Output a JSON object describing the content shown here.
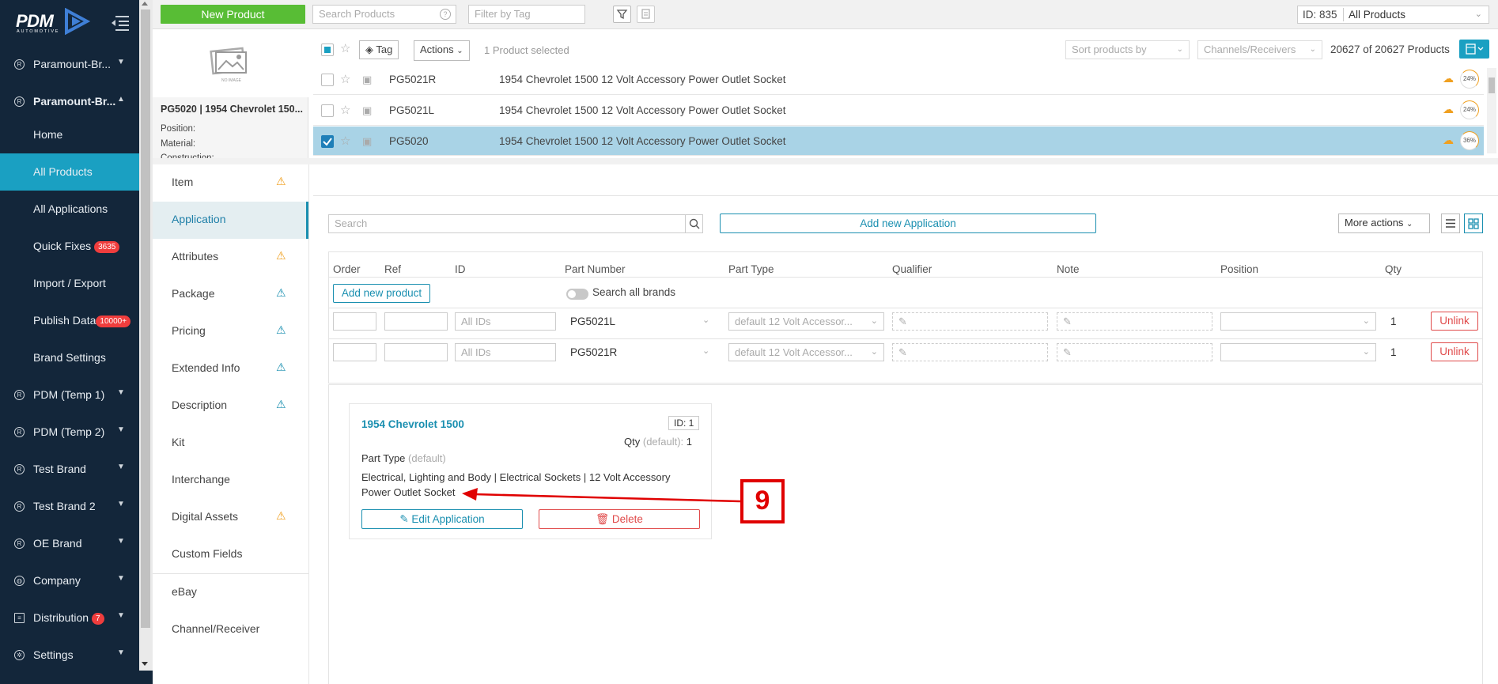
{
  "sidebar": {
    "logo_text": "PDM",
    "logo_sub": "AUTOMOTIVE",
    "items": [
      {
        "label": "Paramount-Br...",
        "type": "brand"
      },
      {
        "label": "Paramount-Br...",
        "type": "brand-open"
      },
      {
        "label": "Home",
        "type": "sub"
      },
      {
        "label": "All Products",
        "type": "sub-active"
      },
      {
        "label": "All Applications",
        "type": "sub"
      },
      {
        "label": "Quick Fixes",
        "type": "sub",
        "badge": "3635"
      },
      {
        "label": "Import / Export",
        "type": "sub"
      },
      {
        "label": "Publish Data",
        "type": "sub",
        "badge": "10000+"
      },
      {
        "label": "Brand Settings",
        "type": "sub"
      },
      {
        "label": "PDM (Temp 1)",
        "type": "brand"
      },
      {
        "label": "PDM (Temp 2)",
        "type": "brand"
      },
      {
        "label": "Test Brand",
        "type": "brand"
      },
      {
        "label": "Test Brand 2",
        "type": "brand"
      },
      {
        "label": "OE Brand",
        "type": "brand"
      },
      {
        "label": "Company",
        "type": "globe"
      },
      {
        "label": "Distribution",
        "type": "dist",
        "badge": "7"
      },
      {
        "label": "Settings",
        "type": "gear"
      }
    ]
  },
  "topbar": {
    "new_product": "New Product",
    "search_placeholder": "Search Products",
    "filter_placeholder": "Filter by Tag",
    "id_label": "ID: 835",
    "view_select": "All Products"
  },
  "product_card": {
    "no_image": "NO IMAGE",
    "title": "PG5020 | 1954 Chevrolet 150...",
    "position_label": "Position:",
    "material_label": "Material:",
    "construction_label": "Construction:"
  },
  "list_toolbar": {
    "tag": "Tag",
    "actions": "Actions",
    "selected": "1 Product selected",
    "sort": "Sort products by",
    "channels": "Channels/Receivers",
    "count": "20627 of 20627 Products"
  },
  "products": [
    {
      "sku": "PG5021R",
      "desc": "1954 Chevrolet 1500 12 Volt Accessory Power Outlet Socket",
      "pct": "24%",
      "selected": false
    },
    {
      "sku": "PG5021L",
      "desc": "1954 Chevrolet 1500 12 Volt Accessory Power Outlet Socket",
      "pct": "24%",
      "selected": false
    },
    {
      "sku": "PG5020",
      "desc": "1954 Chevrolet 1500 12 Volt Accessory Power Outlet Socket",
      "pct": "36%",
      "selected": true
    }
  ],
  "left_nav": [
    {
      "label": "Item",
      "warn": "orange"
    },
    {
      "label": "Application",
      "warn": "",
      "active": true
    },
    {
      "label": "Attributes",
      "warn": "orange"
    },
    {
      "label": "Package",
      "warn": "blue"
    },
    {
      "label": "Pricing",
      "warn": "blue"
    },
    {
      "label": "Extended Info",
      "warn": "blue"
    },
    {
      "label": "Description",
      "warn": "blue"
    },
    {
      "label": "Kit",
      "warn": ""
    },
    {
      "label": "Interchange",
      "warn": ""
    },
    {
      "label": "Digital Assets",
      "warn": "orange"
    },
    {
      "label": "Custom Fields",
      "warn": ""
    },
    {
      "label": "eBay",
      "warn": ""
    },
    {
      "label": "Channel/Receiver",
      "warn": ""
    }
  ],
  "app_toolbar": {
    "search_placeholder": "Search",
    "add_app": "Add new Application",
    "more_actions": "More actions"
  },
  "table": {
    "headers": [
      "Order",
      "Ref",
      "ID",
      "Part Number",
      "Part Type",
      "Qualifier",
      "Note",
      "Position",
      "Qty"
    ],
    "add_product": "Add new product",
    "search_all_brands": "Search all brands",
    "ids_placeholder": "All IDs",
    "rows": [
      {
        "part_number": "PG5021L",
        "part_type": "default 12 Volt Accessor...",
        "qty": "1",
        "unlink": "Unlink"
      },
      {
        "part_number": "PG5021R",
        "part_type": "default 12 Volt Accessor...",
        "qty": "1",
        "unlink": "Unlink"
      }
    ]
  },
  "app_card": {
    "title": "1954 Chevrolet 1500",
    "id": "ID: 1",
    "qty_label": "Qty",
    "qty_default": "(default):",
    "qty_value": "1",
    "part_type_label": "Part Type",
    "part_type_default": "(default)",
    "description_line1": "Electrical, Lighting and Body | Electrical Sockets | 12 Volt Accessory",
    "description_line2": "Power Outlet Socket",
    "edit": "Edit Application",
    "delete": "Delete"
  },
  "annotation": {
    "number": "9",
    "color": "#e00000"
  },
  "colors": {
    "sidebar_bg": "#13263a",
    "accent": "#1aa0c2",
    "green": "#58bd35",
    "danger": "#e04a4a",
    "warn_orange": "#f0a020",
    "warn_blue": "#1a8fb0"
  }
}
